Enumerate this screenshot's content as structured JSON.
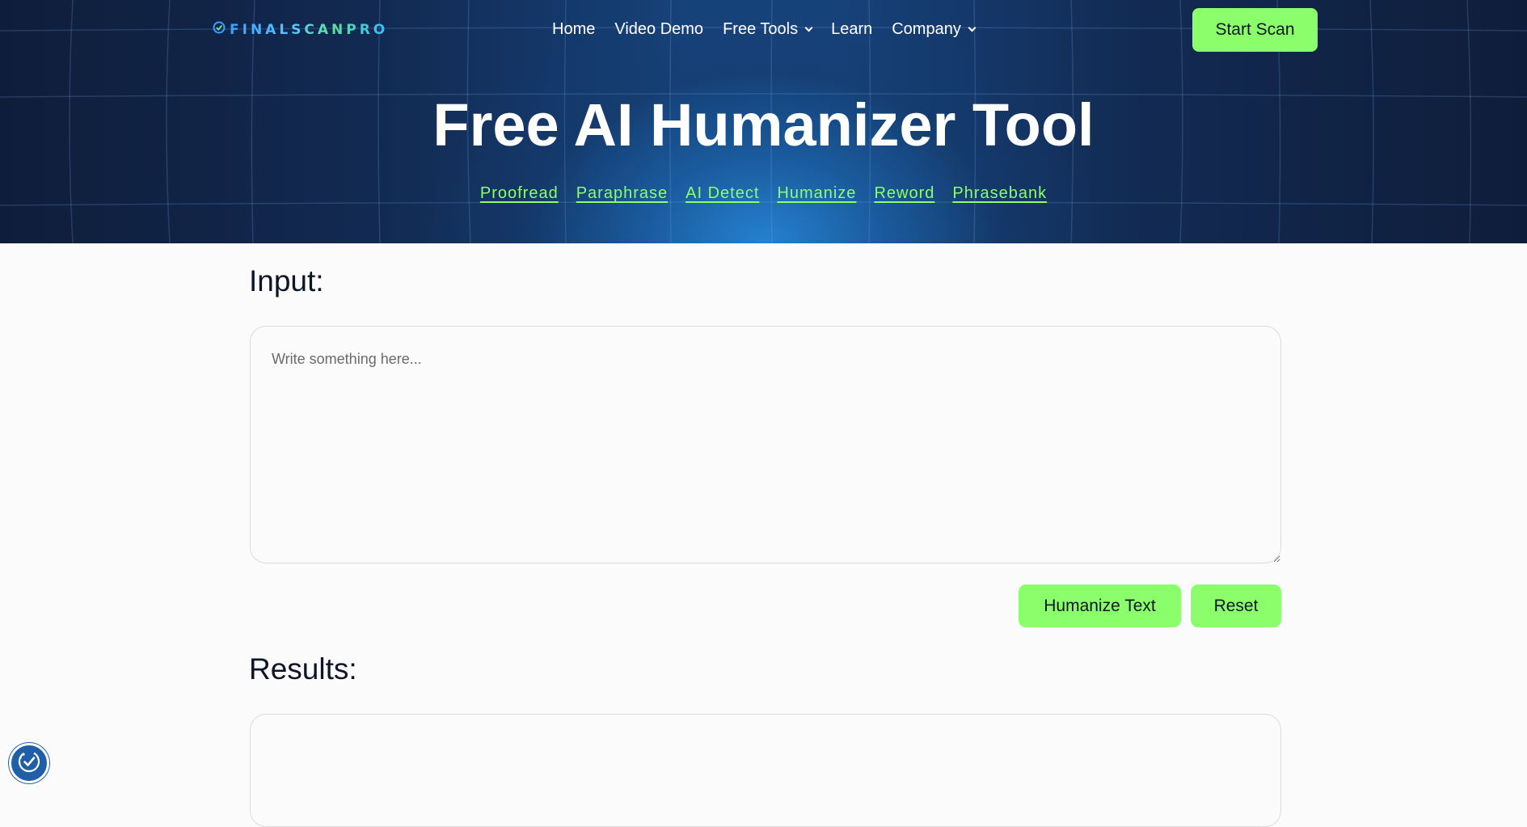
{
  "header": {
    "logo_text": "FINALSCANPRO",
    "nav": [
      {
        "label": "Home",
        "has_dropdown": false
      },
      {
        "label": "Video Demo",
        "has_dropdown": false
      },
      {
        "label": "Free Tools",
        "has_dropdown": true
      },
      {
        "label": "Learn",
        "has_dropdown": false
      },
      {
        "label": "Company",
        "has_dropdown": true
      }
    ],
    "cta_label": "Start Scan"
  },
  "hero": {
    "title": "Free AI Humanizer Tool",
    "tool_links": [
      "Proofread",
      "Paraphrase",
      "AI Detect",
      "Humanize",
      "Reword",
      "Phrasebank"
    ]
  },
  "main": {
    "input_title": "Input:",
    "input_placeholder": "Write something here...",
    "input_value": "",
    "humanize_button": "Humanize Text",
    "reset_button": "Reset",
    "results_title": "Results:",
    "results_value": ""
  },
  "icons": {
    "logo": "check-badge-icon",
    "dropdown": "chevron-down-icon",
    "accessibility": "accessibility-icon"
  },
  "colors": {
    "accent": "#8bff6b",
    "hero_dark": "#0f1d3a",
    "hero_glow": "#2684d4",
    "text": "#0d1526",
    "a11y": "#1e5fa8"
  }
}
